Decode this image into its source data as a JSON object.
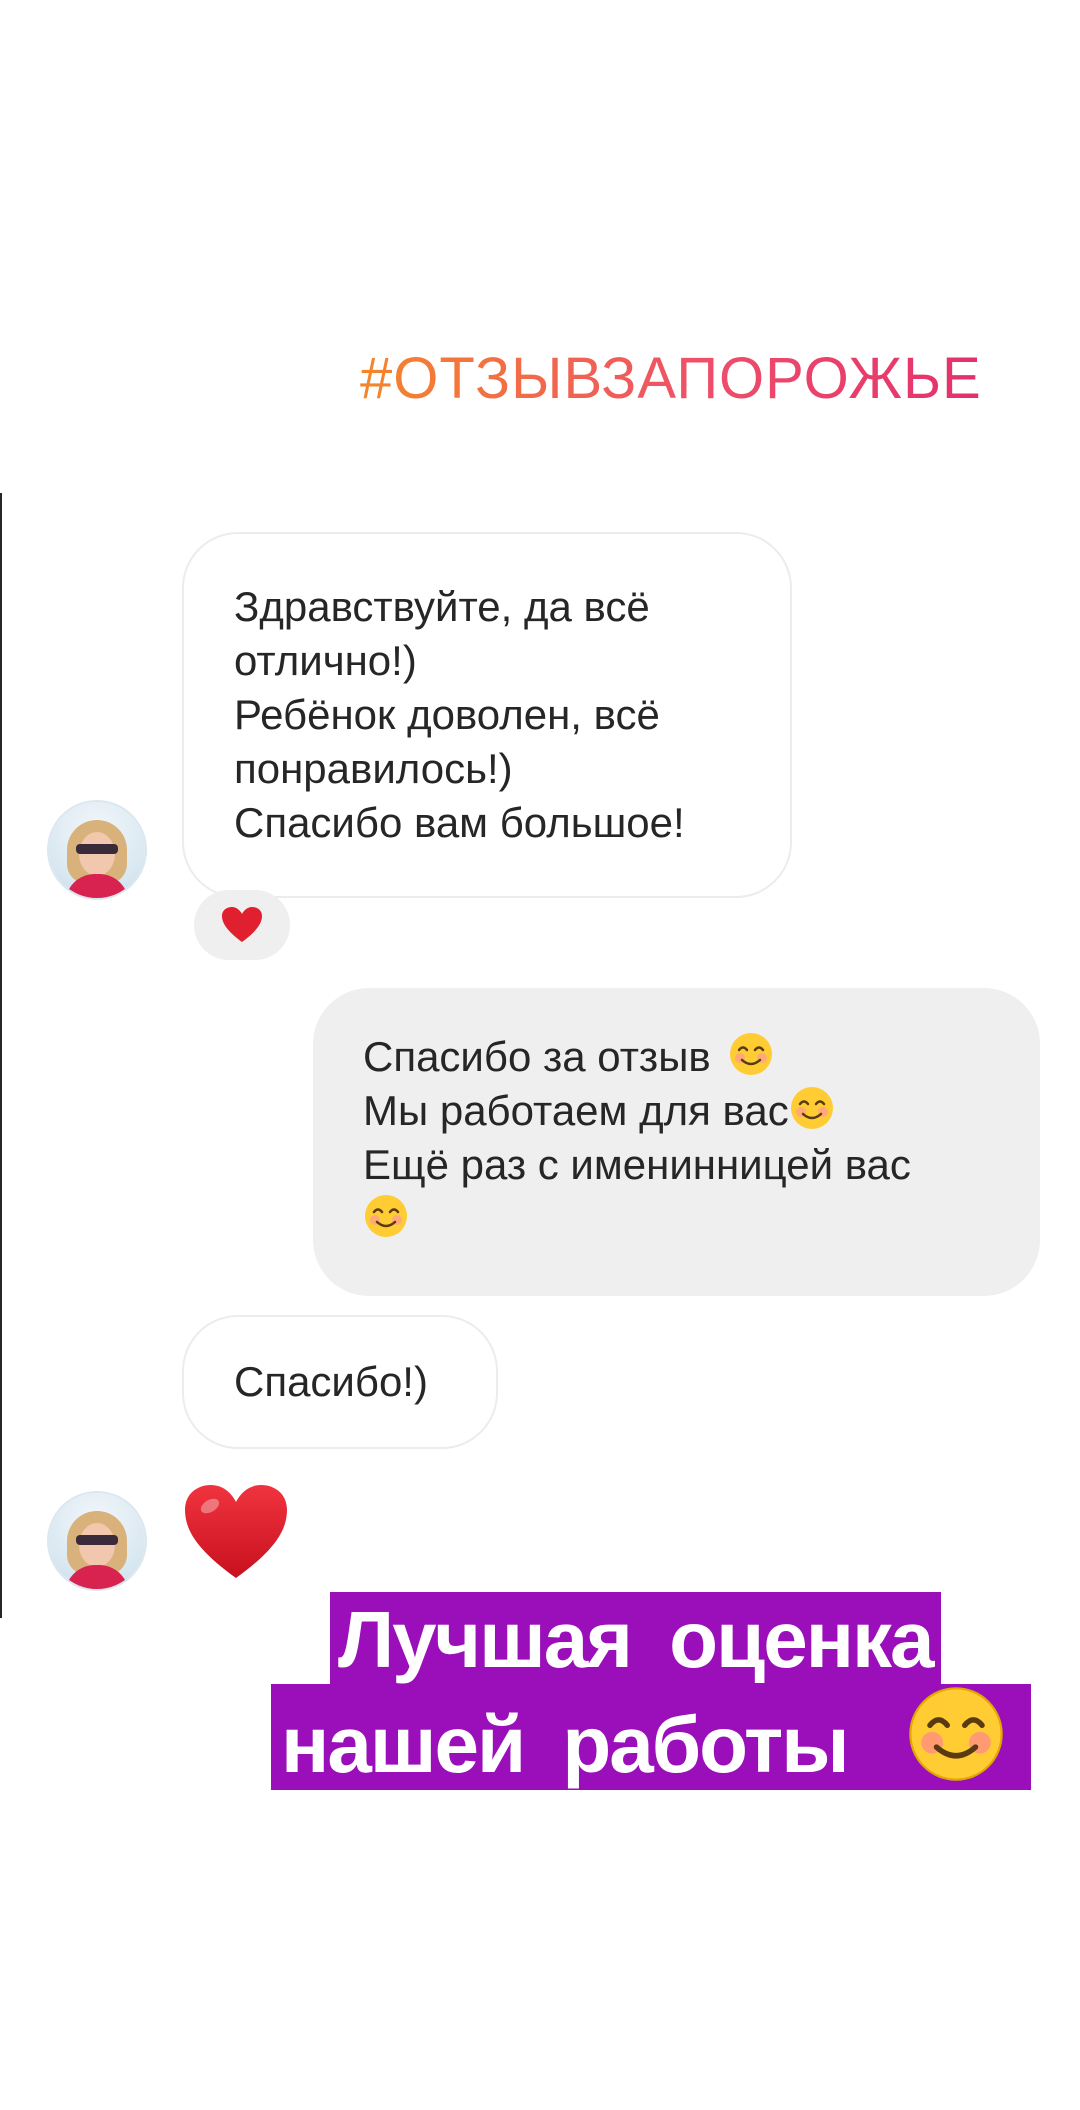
{
  "header": {
    "hashtag": "#ОТЗЫВЗАПОРОЖЬЕ"
  },
  "messages": [
    {
      "direction": "incoming",
      "lines": [
        "Здравствуйте, да всё",
        "отлично!)",
        "Ребёнок доволен, всё",
        "понравилось!)",
        "Спасибо вам большое!"
      ],
      "reaction": "heart"
    },
    {
      "direction": "outgoing",
      "lines": [
        "Спасибо за отзыв",
        "Мы работаем для вас",
        "Ещё раз с именинницей вас"
      ]
    },
    {
      "direction": "incoming",
      "lines": [
        "Спасибо!)"
      ]
    },
    {
      "direction": "incoming",
      "sticker": "heart"
    }
  ],
  "caption": {
    "line1": "Лучшая оценка",
    "line2": "нашей работы"
  },
  "colors": {
    "hashtag_gradient_start": "#f58529",
    "hashtag_gradient_end": "#e4306c",
    "incoming_bubble": "#ffffff",
    "outgoing_bubble": "#efefef",
    "caption_background": "#9a0fb9",
    "heart": "#e0202e"
  },
  "icons": {
    "reaction_icon": "heart-icon",
    "emoji_icon": "smiling-face-emoji-icon",
    "avatar_icon": "user-avatar"
  }
}
